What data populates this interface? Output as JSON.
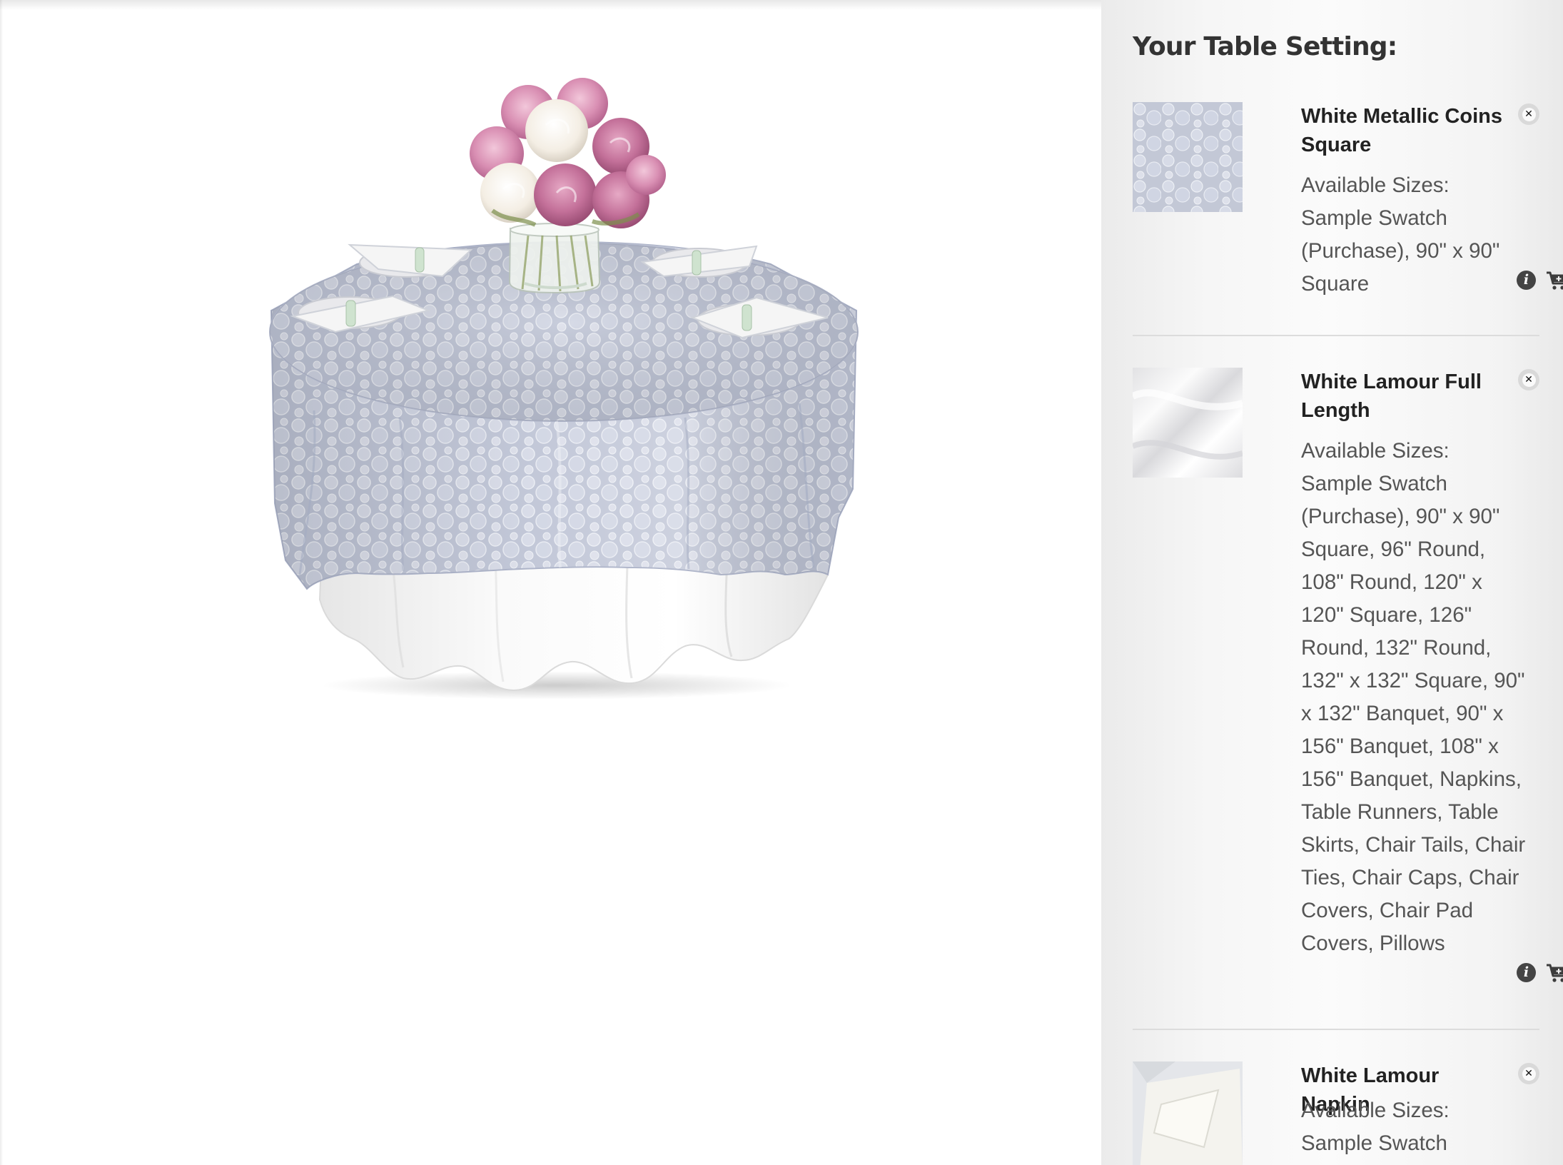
{
  "sidebar": {
    "title": "Your Table Setting:",
    "items": [
      {
        "name": "White Metallic Coins Square",
        "sizes_label": "Available Sizes:",
        "sizes": "Sample Swatch (Purchase), 90\" x 90\" Square"
      },
      {
        "name": "White Lamour Full Length",
        "sizes_label": "Available Sizes:",
        "sizes": "Sample Swatch (Purchase), 90\" x 90\" Square, 96\" Round, 108\" Round, 120\" x 120\" Square, 126\" Round, 132\" Round, 132\" x 132\" Square, 90\" x 132\" Banquet, 90\" x 156\" Banquet, 108\" x 156\" Banquet, Napkins, Table Runners, Table Skirts, Chair Tails, Chair Ties, Chair Caps, Chair Covers, Chair Pad Covers, Pillows"
      },
      {
        "name": "White Lamour Napkin",
        "sizes_label": "Available Sizes:",
        "sizes": "Sample Swatch"
      }
    ]
  },
  "icons": {
    "remove": "close-icon",
    "info": "info-icon",
    "cart": "add-to-cart-icon"
  },
  "colors": {
    "overlay": "#b9bfd2",
    "tablecloth": "#f4f4f4",
    "peony_pink": "#d98fb3",
    "peony_white": "#f7f2ea"
  }
}
